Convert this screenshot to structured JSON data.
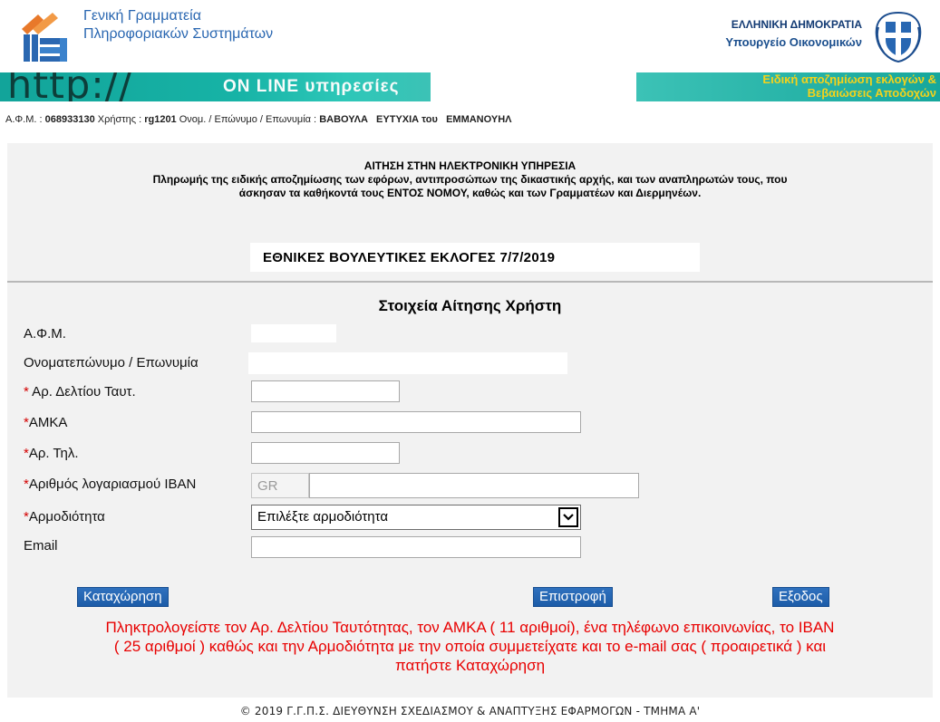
{
  "header": {
    "gsis_line1": "Γενική Γραμματεία",
    "gsis_line2": "Πληροφοριακών Συστημάτων",
    "gr_line1": "ΕΛΛΗΝΙΚΗ ΔΗΜΟΚΡΑΤΙΑ",
    "gr_line2": "Υπουργείο Οικονομικών"
  },
  "banner": {
    "http_text": "http://",
    "online_text": "ON LINE υπηρεσίες",
    "right_line1": "Ειδική αποζημίωση εκλογών &",
    "right_line2": "Βεβαιώσεις Αποδοχών",
    "colors": {
      "bar": "#17b3a6",
      "accent_text": "#f4d21b"
    }
  },
  "userinfo": {
    "afm_label": "Α.Φ.Μ. :",
    "afm_value": "068933130",
    "user_label": "Χρήστης :",
    "user_value": "rg1201",
    "name_label": "Ονομ. / Επώνυμο / Επωνυμία :",
    "name_value": "ΒΑΒΟΥΛΑ   ΕΥΤΥΧΙΑ του   ΕΜΜΑΝΟΥΗΛ"
  },
  "app_header": {
    "line1": "ΑΙΤΗΣΗ ΣΤΗΝ ΗΛΕΚΤΡΟΝΙΚΗ ΥΠΗΡΕΣΙΑ",
    "line2": "Πληρωμής της ειδικής αποζημίωσης των εφόρων, αντιπροσώπων της δικαστικής αρχής, και των αναπληρωτών τους, που",
    "line3": "άσκησαν τα καθήκοντά τους ΕΝΤΟΣ ΝΟΜΟΥ, καθώς και των Γραμματέων και Διερμηνέων."
  },
  "election_title": "ΕΘΝΙΚΕΣ ΒΟΥΛΕΥΤΙΚΕΣ ΕΚΛΟΓΕΣ 7/7/2019",
  "form": {
    "section_title": "Στοιχεία Αίτησης Χρήστη",
    "required_mark": "*",
    "fields": {
      "afm_label": "Α.Φ.Μ.",
      "name_label": "Ονοματεπώνυμο / Επωνυμία",
      "id_label": " Αρ. Δελτίου Ταυτ.",
      "amka_label": "ΑΜΚΑ",
      "phone_label": "Αρ. Τηλ.",
      "iban_label": "Αριθμός λογαριασμού IBAN",
      "iban_prefix": "GR",
      "authority_label": "Αρμοδιότητα",
      "authority_selected": "Επιλέξτε αρμοδιότητα",
      "email_label": "Email"
    }
  },
  "buttons": {
    "submit": "Καταχώρηση",
    "back": "Επιστροφή",
    "exit": "Εξοδος"
  },
  "instructions": {
    "line1": "Πληκτρολογείστε τον Αρ. Δελτίου Ταυτότητας, τον ΑΜΚΑ ( 11 αριθμοί), ένα τηλέφωνο επικοινωνίας, το IBAN",
    "line2": "( 25 αριθμοί ) καθώς και την Αρμοδιότητα με την οποία συμμετείχατε και το e-mail σας ( προαιρετικά ) και",
    "line3": "πατήστε Καταχώρηση"
  },
  "footer": "© 2019 Γ.Γ.Π.Σ. ΔΙΕΥΘΥΝΣΗ ΣΧΕΔΙΑΣΜΟΥ & ΑΝΑΠΤΥΞΗΣ ΕΦΑΡΜΟΓΩΝ - ΤΜΗΜΑ Α'"
}
